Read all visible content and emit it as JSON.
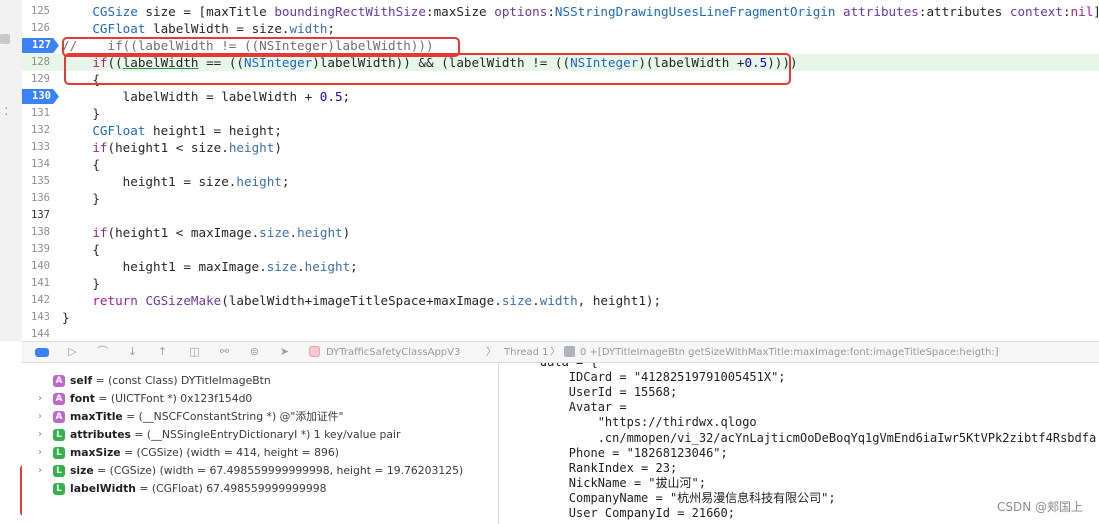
{
  "editor": {
    "lines": [
      {
        "no": "125",
        "html": "    <span class='ty'>CGSize</span> size = [maxTitle <span class='fn'>boundingRectWithSize</span>:maxSize <span class='fn'>options</span>:<span class='ty'>NSStringDrawingUsesLineFragmentOrigin</span> <span class='fn'>attributes</span>:attributes <span class='fn'>context</span>:<span class='kw'>nil</span>].<span class='prop'>size</span>;"
      },
      {
        "no": "126",
        "html": "    <span class='ty'>CGFloat</span> labelWidth = size.<span class='prop'>width</span>;"
      },
      {
        "no": "127",
        "bp": true,
        "comment": true,
        "html": "//    if((labelWidth != ((NSInteger)labelWidth)))"
      },
      {
        "no": "128",
        "hl": true,
        "html": "    <span class='kw'>if</span>((<span class='ul'>labelWidth</span> == ((<span class='ty'>NSInteger</span>)labelWidth)) &amp;&amp; (labelWidth != ((<span class='ty'>NSInteger</span>)(labelWidth +<span class='num'>0.5</span>))))"
      },
      {
        "no": "129",
        "html": "    {"
      },
      {
        "no": "130",
        "bp": true,
        "html": "        labelWidth = labelWidth + <span class='num'>0.5</span>;"
      },
      {
        "no": "131",
        "html": "    }"
      },
      {
        "no": "132",
        "html": "    <span class='ty'>CGFloat</span> height1 = height;"
      },
      {
        "no": "133",
        "html": "    <span class='kw'>if</span>(height1 &lt; size.<span class='prop'>height</span>)"
      },
      {
        "no": "134",
        "html": "    {"
      },
      {
        "no": "135",
        "html": "        height1 = size.<span class='prop'>height</span>;"
      },
      {
        "no": "136",
        "html": "    }"
      },
      {
        "no": "137",
        "bold": true,
        "html": ""
      },
      {
        "no": "138",
        "html": "    <span class='kw'>if</span>(height1 &lt; maxImage.<span class='prop'>size</span>.<span class='prop'>height</span>)"
      },
      {
        "no": "139",
        "html": "    {"
      },
      {
        "no": "140",
        "html": "        height1 = maxImage.<span class='prop'>size</span>.<span class='prop'>height</span>;"
      },
      {
        "no": "141",
        "html": "    }"
      },
      {
        "no": "142",
        "html": "    <span class='kw'>return</span> <span class='fn'>CGSizeMake</span>(labelWidth+imageTitleSpace+maxImage.<span class='prop'>size</span>.<span class='prop'>width</span>, height1);"
      },
      {
        "no": "143",
        "html": "}"
      },
      {
        "no": "144",
        "html": ""
      }
    ]
  },
  "toolbar": {
    "app": "DYTrafficSafetyClassAppV3",
    "sep1": "〉",
    "thread": "Thread 1",
    "sep2": "〉",
    "frame": "0 +[DYTitleImageBtn getSizeWithMaxTitle:maxImage:font:imageTitleSpace:heigth:]",
    "icons": [
      "panel-toggle-icon",
      "continue-icon",
      "step-over-icon",
      "step-into-icon",
      "step-out-icon",
      "debug-view-hierarchy-icon",
      "memory-graph-icon",
      "environment-icon",
      "location-icon"
    ]
  },
  "variables": [
    {
      "expand": false,
      "badge": "A",
      "name": "self",
      "value": " = (const Class) DYTitleImageBtn"
    },
    {
      "expand": true,
      "badge": "A",
      "name": "font",
      "value": " = (UICTFont *) 0x123f154d0"
    },
    {
      "expand": true,
      "badge": "A",
      "name": "maxTitle",
      "value": " = (__NSCFConstantString *) @\"添加证件\""
    },
    {
      "expand": true,
      "badge": "L",
      "name": "attributes",
      "value": " = (__NSSingleEntryDictionaryI *) 1 key/value pair"
    },
    {
      "expand": true,
      "badge": "L",
      "name": "maxSize",
      "value": " = (CGSize) (width = 414, height = 896)"
    },
    {
      "expand": true,
      "badge": "L",
      "name": "size",
      "value": " = (CGSize) (width = 67.498559999999998, height = 19.76203125)"
    },
    {
      "expand": false,
      "badge": "L",
      "name": "labelWidth",
      "value": " = (CGFloat) 67.498559999999998"
    }
  ],
  "console": {
    "lines": [
      "    data = {",
      "        IDCard = \"41282519791005451X\";",
      "        UserId = 15568;",
      "        Avatar =",
      "            \"https://thirdwx.qlogo",
      "            .cn/mmopen/vi_32/acYnLajticmOoDeBoqYq1gVmEnd6iaIwr5KtVPk2zibtf4Rsbdfa",
      "        Phone = \"18268123046\";",
      "        RankIndex = 23;",
      "        NickName = \"拔山河\";",
      "        CompanyName = \"杭州易漫信息科技有限公司\";",
      "        User CompanyId = 21660;"
    ]
  },
  "watermark": "CSDN @郏国上",
  "colors": {
    "breakpoint": "#3b82f6",
    "highlight": "#e8f6ea",
    "annotation": "#e53935"
  }
}
